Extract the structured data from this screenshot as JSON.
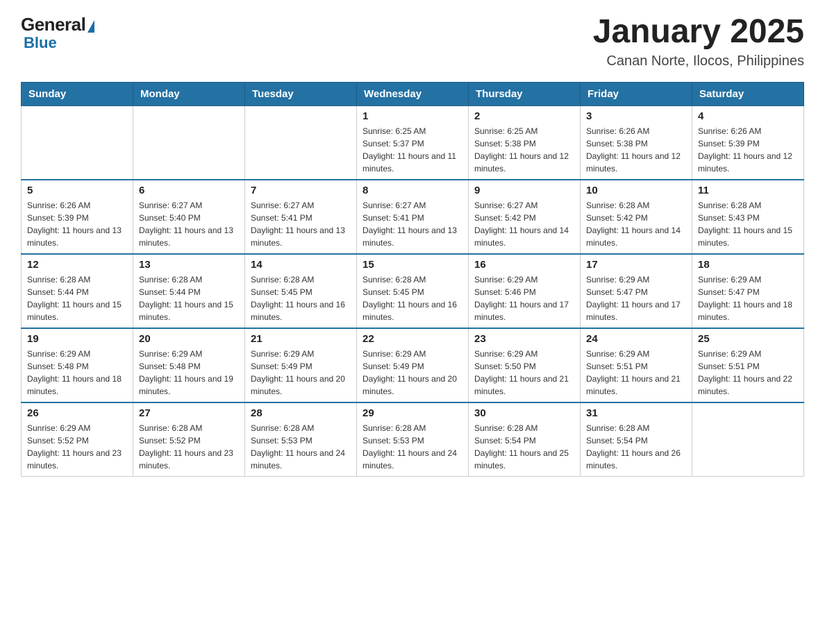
{
  "header": {
    "logo_general": "General",
    "logo_blue": "Blue",
    "title": "January 2025",
    "subtitle": "Canan Norte, Ilocos, Philippines"
  },
  "weekdays": [
    "Sunday",
    "Monday",
    "Tuesday",
    "Wednesday",
    "Thursday",
    "Friday",
    "Saturday"
  ],
  "weeks": [
    [
      {
        "num": "",
        "info": ""
      },
      {
        "num": "",
        "info": ""
      },
      {
        "num": "",
        "info": ""
      },
      {
        "num": "1",
        "info": "Sunrise: 6:25 AM\nSunset: 5:37 PM\nDaylight: 11 hours and 11 minutes."
      },
      {
        "num": "2",
        "info": "Sunrise: 6:25 AM\nSunset: 5:38 PM\nDaylight: 11 hours and 12 minutes."
      },
      {
        "num": "3",
        "info": "Sunrise: 6:26 AM\nSunset: 5:38 PM\nDaylight: 11 hours and 12 minutes."
      },
      {
        "num": "4",
        "info": "Sunrise: 6:26 AM\nSunset: 5:39 PM\nDaylight: 11 hours and 12 minutes."
      }
    ],
    [
      {
        "num": "5",
        "info": "Sunrise: 6:26 AM\nSunset: 5:39 PM\nDaylight: 11 hours and 13 minutes."
      },
      {
        "num": "6",
        "info": "Sunrise: 6:27 AM\nSunset: 5:40 PM\nDaylight: 11 hours and 13 minutes."
      },
      {
        "num": "7",
        "info": "Sunrise: 6:27 AM\nSunset: 5:41 PM\nDaylight: 11 hours and 13 minutes."
      },
      {
        "num": "8",
        "info": "Sunrise: 6:27 AM\nSunset: 5:41 PM\nDaylight: 11 hours and 13 minutes."
      },
      {
        "num": "9",
        "info": "Sunrise: 6:27 AM\nSunset: 5:42 PM\nDaylight: 11 hours and 14 minutes."
      },
      {
        "num": "10",
        "info": "Sunrise: 6:28 AM\nSunset: 5:42 PM\nDaylight: 11 hours and 14 minutes."
      },
      {
        "num": "11",
        "info": "Sunrise: 6:28 AM\nSunset: 5:43 PM\nDaylight: 11 hours and 15 minutes."
      }
    ],
    [
      {
        "num": "12",
        "info": "Sunrise: 6:28 AM\nSunset: 5:44 PM\nDaylight: 11 hours and 15 minutes."
      },
      {
        "num": "13",
        "info": "Sunrise: 6:28 AM\nSunset: 5:44 PM\nDaylight: 11 hours and 15 minutes."
      },
      {
        "num": "14",
        "info": "Sunrise: 6:28 AM\nSunset: 5:45 PM\nDaylight: 11 hours and 16 minutes."
      },
      {
        "num": "15",
        "info": "Sunrise: 6:28 AM\nSunset: 5:45 PM\nDaylight: 11 hours and 16 minutes."
      },
      {
        "num": "16",
        "info": "Sunrise: 6:29 AM\nSunset: 5:46 PM\nDaylight: 11 hours and 17 minutes."
      },
      {
        "num": "17",
        "info": "Sunrise: 6:29 AM\nSunset: 5:47 PM\nDaylight: 11 hours and 17 minutes."
      },
      {
        "num": "18",
        "info": "Sunrise: 6:29 AM\nSunset: 5:47 PM\nDaylight: 11 hours and 18 minutes."
      }
    ],
    [
      {
        "num": "19",
        "info": "Sunrise: 6:29 AM\nSunset: 5:48 PM\nDaylight: 11 hours and 18 minutes."
      },
      {
        "num": "20",
        "info": "Sunrise: 6:29 AM\nSunset: 5:48 PM\nDaylight: 11 hours and 19 minutes."
      },
      {
        "num": "21",
        "info": "Sunrise: 6:29 AM\nSunset: 5:49 PM\nDaylight: 11 hours and 20 minutes."
      },
      {
        "num": "22",
        "info": "Sunrise: 6:29 AM\nSunset: 5:49 PM\nDaylight: 11 hours and 20 minutes."
      },
      {
        "num": "23",
        "info": "Sunrise: 6:29 AM\nSunset: 5:50 PM\nDaylight: 11 hours and 21 minutes."
      },
      {
        "num": "24",
        "info": "Sunrise: 6:29 AM\nSunset: 5:51 PM\nDaylight: 11 hours and 21 minutes."
      },
      {
        "num": "25",
        "info": "Sunrise: 6:29 AM\nSunset: 5:51 PM\nDaylight: 11 hours and 22 minutes."
      }
    ],
    [
      {
        "num": "26",
        "info": "Sunrise: 6:29 AM\nSunset: 5:52 PM\nDaylight: 11 hours and 23 minutes."
      },
      {
        "num": "27",
        "info": "Sunrise: 6:28 AM\nSunset: 5:52 PM\nDaylight: 11 hours and 23 minutes."
      },
      {
        "num": "28",
        "info": "Sunrise: 6:28 AM\nSunset: 5:53 PM\nDaylight: 11 hours and 24 minutes."
      },
      {
        "num": "29",
        "info": "Sunrise: 6:28 AM\nSunset: 5:53 PM\nDaylight: 11 hours and 24 minutes."
      },
      {
        "num": "30",
        "info": "Sunrise: 6:28 AM\nSunset: 5:54 PM\nDaylight: 11 hours and 25 minutes."
      },
      {
        "num": "31",
        "info": "Sunrise: 6:28 AM\nSunset: 5:54 PM\nDaylight: 11 hours and 26 minutes."
      },
      {
        "num": "",
        "info": ""
      }
    ]
  ]
}
